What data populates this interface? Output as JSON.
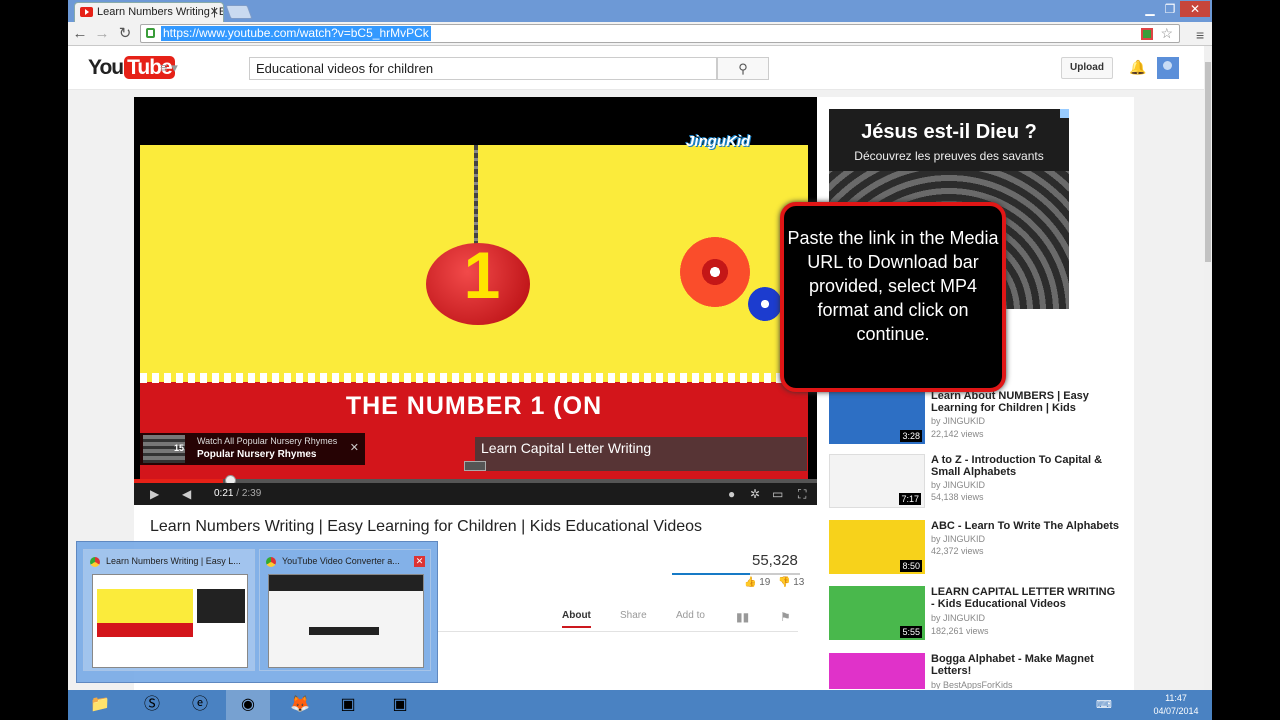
{
  "browser": {
    "tab_title": "Learn Numbers Writing | E",
    "tab_close": "✕",
    "url": "https://www.youtube.com/watch?v=bC5_hrMvPCk",
    "nav": {
      "back": "←",
      "forward": "→",
      "reload": "↻",
      "menu": "≡"
    },
    "window": {
      "minimize": "▁",
      "restore": "❐",
      "close": "✕"
    }
  },
  "youtube": {
    "logo_you": "You",
    "logo_tube": "Tube",
    "search_value": "Educational videos for children",
    "upload_label": "Upload"
  },
  "player": {
    "brand": "JinguKid",
    "digit": "1",
    "banner_text": "THE NUMBER 1 (ON",
    "annotation1": {
      "count": "15",
      "line1": "Watch All Popular Nursery Rhymes",
      "line2": "Popular Nursery Rhymes",
      "close": "✕"
    },
    "annotation2": "Learn Capital Letter Writing",
    "time_current": "0:21",
    "time_total": "2:39",
    "progress_fraction": 0.13,
    "knob_fraction": 0.14
  },
  "ad": {
    "headline": "Jésus est-il Dieu ?",
    "sub": "Découvrez les preuves des savants"
  },
  "popup_text": "Paste the link in the Media URL to Download bar provided, select MP4 format and click on continue.",
  "video": {
    "title": "Learn Numbers Writing | Easy Learning for Children | Kids Educational Videos",
    "views": "55,328",
    "likes": "19",
    "dislikes": "13",
    "tabs": [
      "About",
      "Share",
      "Add to"
    ]
  },
  "suggestions": [
    {
      "title": "Learn About NUMBERS | Easy Learning for Children | Kids",
      "by": "by JINGUKID",
      "views": "22,142 views",
      "duration": "3:28",
      "color": "#2d6fc4"
    },
    {
      "title": "A to Z - Introduction To Capital & Small Alphabets",
      "by": "by JINGUKID",
      "views": "54,138 views",
      "duration": "7:17",
      "color": "#f3f3f3"
    },
    {
      "title": "ABC - Learn To Write The Alphabets",
      "by": "by JINGUKID",
      "views": "42,372 views",
      "duration": "8:50",
      "color": "#f7d21b"
    },
    {
      "title": "LEARN CAPITAL LETTER WRITING - Kids Educational Videos",
      "by": "by JINGUKID",
      "views": "182,261 views",
      "duration": "5:55",
      "color": "#49b84c"
    },
    {
      "title": "Bogga Alphabet - Make Magnet Letters!",
      "by": "by BestAppsForKids",
      "views": "",
      "duration": "",
      "color": "#e032c9"
    }
  ],
  "previews": [
    {
      "title": "Learn Numbers Writing | Easy L..."
    },
    {
      "title": "YouTube Video Converter a...",
      "close": "✕"
    }
  ],
  "taskbar": {
    "time": "11:47",
    "date": "04/07/2014",
    "apps": [
      "explorer",
      "skype",
      "ie",
      "chrome",
      "firefox",
      "app1",
      "app2"
    ]
  }
}
